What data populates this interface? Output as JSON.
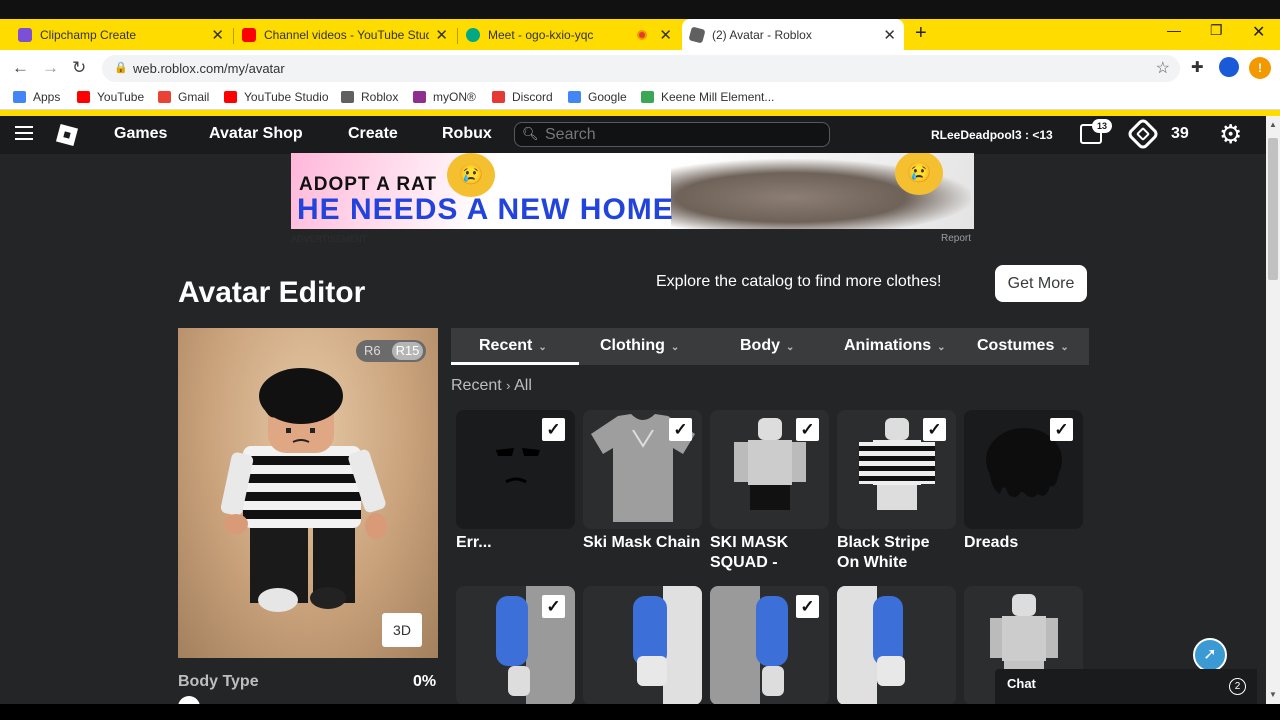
{
  "browser": {
    "tabs": [
      {
        "title": "Clipchamp Create",
        "color": "#7b4fd6"
      },
      {
        "title": "Channel videos - YouTube Studio",
        "color": "#ff0000"
      },
      {
        "title": "Meet - ogo-kxio-yqc",
        "color": "#00a884"
      },
      {
        "title": "(2) Avatar - Roblox",
        "color": "#606060"
      }
    ],
    "url": "web.roblox.com/my/avatar",
    "bookmarks": [
      {
        "label": "Apps",
        "color": "#4285f4"
      },
      {
        "label": "YouTube",
        "color": "#ff0000"
      },
      {
        "label": "Gmail",
        "color": "#ea4335"
      },
      {
        "label": "YouTube Studio",
        "color": "#ff0000"
      },
      {
        "label": "Roblox",
        "color": "#606060"
      },
      {
        "label": "myON®",
        "color": "#8e2f8f"
      },
      {
        "label": "Discord",
        "color": "#e53935"
      },
      {
        "label": "Google",
        "color": "#4285f4"
      },
      {
        "label": "Keene Mill Element...",
        "color": "#3aa757"
      }
    ]
  },
  "nav": {
    "links": [
      "Games",
      "Avatar Shop",
      "Create",
      "Robux"
    ],
    "search_placeholder": "Search",
    "username": "RLeeDeadpool3 : <13",
    "messages_count": "13",
    "robux": "39"
  },
  "ad": {
    "line1": "ADOPT A RAT",
    "line2": "HE NEEDS A NEW HOME",
    "label": "ADVERTISEMENT",
    "report": "Report"
  },
  "editor": {
    "title": "Avatar Editor",
    "explore_text": "Explore the catalog to find more clothes!",
    "get_more": "Get More",
    "rig": {
      "r6": "R6",
      "r15": "R15"
    },
    "view_3d": "3D",
    "body_type_label": "Body Type",
    "body_type_value": "0%",
    "tabs": [
      "Recent",
      "Clothing",
      "Body",
      "Animations",
      "Costumes"
    ],
    "breadcrumb": {
      "parent": "Recent",
      "current": "All"
    },
    "items_row1": [
      {
        "name": "Err...",
        "checked": true
      },
      {
        "name": "Ski Mask Chain",
        "checked": true
      },
      {
        "name": "SKI MASK SQUAD -",
        "checked": true
      },
      {
        "name": "Black Stripe On White",
        "checked": true
      },
      {
        "name": "Dreads",
        "checked": true
      }
    ],
    "items_row2_checked": [
      true,
      false,
      true,
      false,
      false
    ]
  },
  "chat": {
    "label": "Chat",
    "count": "2"
  }
}
